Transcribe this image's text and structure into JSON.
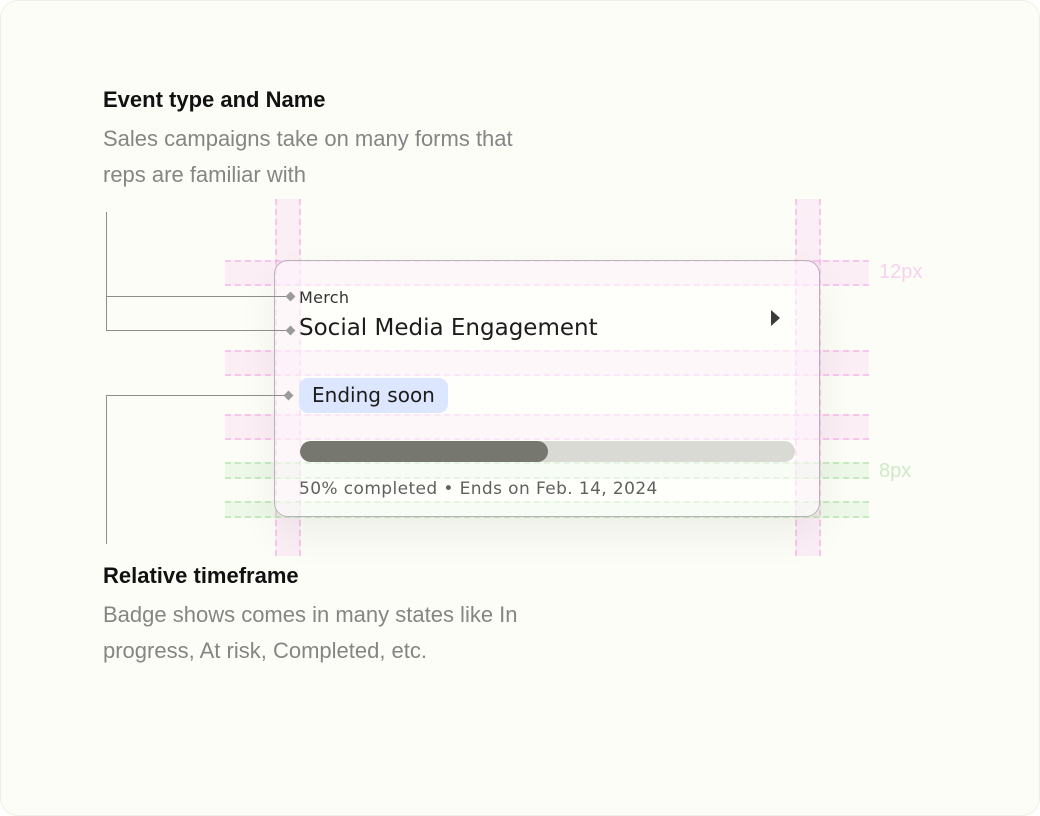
{
  "annotations": {
    "top": {
      "title": "Event type and Name",
      "body": "Sales campaigns take on many forms that reps are familiar with"
    },
    "bottom": {
      "title": "Relative timeframe",
      "body": "Badge shows comes in many states like In progress, At risk, Completed, etc."
    }
  },
  "spacing_labels": {
    "pink": "12px",
    "green": "8px"
  },
  "card": {
    "event_type": "Merch",
    "event_name": "Social Media Engagement",
    "badge": "Ending soon",
    "progress_fraction": 0.5,
    "meta": "50% completed • Ends on Feb. 14, 2024",
    "chevron_icon": "chevron-right-icon"
  },
  "colors": {
    "background": "#fcfdf6",
    "badge_bg": "#dde6ff",
    "progress_fill": "#767870",
    "progress_track": "#dadad5",
    "guide_pink": "#fabaeb",
    "guide_green": "#bee8b4"
  }
}
